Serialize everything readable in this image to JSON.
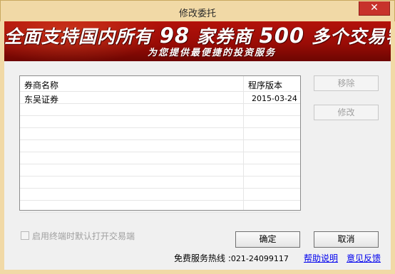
{
  "window": {
    "title": "修改委托",
    "close_glyph": "✕"
  },
  "banner": {
    "main_part1": "全面支持国内所有",
    "main_num1": "98",
    "main_part2": "家券商",
    "main_num2": "500",
    "main_part3": "多个交易客户端",
    "subtitle": "为您提供最便捷的投资服务",
    "colors": {
      "background": "#a60f08",
      "text": "#ffffff"
    }
  },
  "table": {
    "columns": [
      "券商名称",
      "程序版本"
    ],
    "rows": [
      {
        "name": "东吴证券",
        "version": "2015-03-24"
      }
    ],
    "empty_row_count": 9
  },
  "buttons": {
    "remove": "移除",
    "edit": "修改",
    "ok": "确定",
    "cancel": "取消"
  },
  "checkbox": {
    "label": "启用终端时默认打开交易端",
    "checked": false,
    "enabled": false
  },
  "footer": {
    "hotline_label": "免费服务热线 :",
    "hotline_number": "021-24099117",
    "help_link": "帮助说明",
    "feedback_link": "意见反馈"
  }
}
